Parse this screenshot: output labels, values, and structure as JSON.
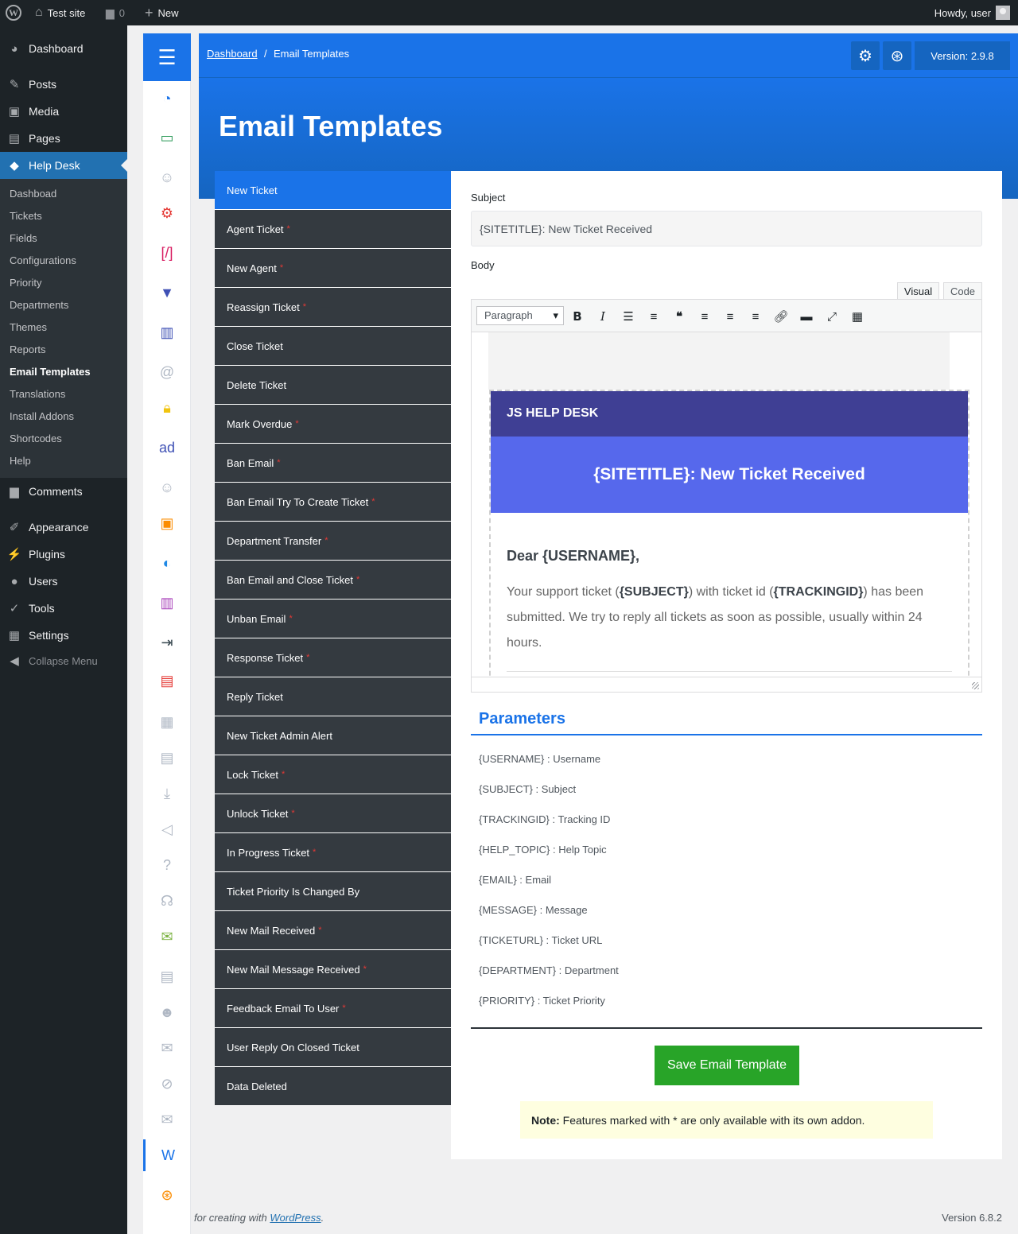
{
  "admin_bar": {
    "site_name": "Test site",
    "comments_count": "0",
    "new_label": "New",
    "howdy": "Howdy, user"
  },
  "admin_menu": {
    "items": [
      {
        "label": "Dashboard",
        "icon": "dashboard-icon"
      },
      {
        "label": "Posts",
        "icon": "pin-icon"
      },
      {
        "label": "Media",
        "icon": "media-icon"
      },
      {
        "label": "Pages",
        "icon": "pages-icon"
      },
      {
        "label": "Help Desk",
        "icon": "tag-icon"
      },
      {
        "label": "Comments",
        "icon": "comment-icon"
      },
      {
        "label": "Appearance",
        "icon": "brush-icon"
      },
      {
        "label": "Plugins",
        "icon": "plug-icon"
      },
      {
        "label": "Users",
        "icon": "user-icon"
      },
      {
        "label": "Tools",
        "icon": "wrench-icon"
      },
      {
        "label": "Settings",
        "icon": "settings-icon"
      },
      {
        "label": "Collapse Menu",
        "icon": "collapse-icon"
      }
    ],
    "submenu": [
      "Dashboad",
      "Tickets",
      "Fields",
      "Configurations",
      "Priority",
      "Departments",
      "Themes",
      "Reports",
      "Email Templates",
      "Translations",
      "Install Addons",
      "Shortcodes",
      "Help"
    ]
  },
  "breadcrumb": {
    "home": "Dashboard",
    "separator": "/",
    "current": "Email Templates"
  },
  "header": {
    "version": "Version: 2.9.8",
    "title": "Email Templates"
  },
  "templates": [
    {
      "label": "New Ticket",
      "addon": false
    },
    {
      "label": "Agent Ticket",
      "addon": true
    },
    {
      "label": "New Agent",
      "addon": true
    },
    {
      "label": "Reassign Ticket",
      "addon": true
    },
    {
      "label": "Close Ticket",
      "addon": false
    },
    {
      "label": "Delete Ticket",
      "addon": false
    },
    {
      "label": "Mark Overdue",
      "addon": true
    },
    {
      "label": "Ban Email",
      "addon": true
    },
    {
      "label": "Ban Email Try To Create Ticket",
      "addon": true
    },
    {
      "label": "Department Transfer",
      "addon": true
    },
    {
      "label": "Ban Email and Close Ticket",
      "addon": true
    },
    {
      "label": "Unban Email",
      "addon": true
    },
    {
      "label": "Response Ticket",
      "addon": true
    },
    {
      "label": "Reply Ticket",
      "addon": false
    },
    {
      "label": "New Ticket Admin Alert",
      "addon": false
    },
    {
      "label": "Lock Ticket",
      "addon": true
    },
    {
      "label": "Unlock Ticket",
      "addon": true
    },
    {
      "label": "In Progress Ticket",
      "addon": true
    },
    {
      "label": "Ticket Priority Is Changed By",
      "addon": false
    },
    {
      "label": "New Mail Received",
      "addon": true
    },
    {
      "label": "New Mail Message Received",
      "addon": true
    },
    {
      "label": "Feedback Email To User",
      "addon": true
    },
    {
      "label": "User Reply On Closed Ticket",
      "addon": false
    },
    {
      "label": "Data Deleted",
      "addon": false
    }
  ],
  "addon_marker": "*",
  "form": {
    "subject_label": "Subject",
    "subject_value": "{SITETITLE}: New Ticket Received",
    "body_label": "Body",
    "tab_visual": "Visual",
    "tab_code": "Code",
    "format_value": "Paragraph"
  },
  "email_preview": {
    "brand": "JS HELP DESK",
    "heading": "{SITETITLE}: New Ticket Received",
    "greeting": "Dear {USERNAME},",
    "text_1": "Your support ticket (",
    "subject_token": "{SUBJECT}",
    "text_2": ") with ticket id (",
    "tracking_token": "{TRACKINGID}",
    "text_3": ") has been submitted. We try to reply all tickets as soon as possible, usually within 24 hours."
  },
  "parameters": {
    "title": "Parameters",
    "items": [
      "{USERNAME} : Username",
      "{SUBJECT} : Subject",
      "{TRACKINGID} : Tracking ID",
      "{HELP_TOPIC} : Help Topic",
      "{EMAIL} : Email",
      "{MESSAGE} : Message",
      "{TICKETURL} : Ticket URL",
      "{DEPARTMENT} : Department",
      "{PRIORITY} : Ticket Priority"
    ]
  },
  "save_button": "Save Email Template",
  "note": {
    "label": "Note:",
    "text": " Features marked with * are only available with its own addon."
  },
  "footer": {
    "left_text": "for creating with ",
    "left_link": "WordPress",
    "left_end": ".",
    "version": "Version 6.8.2"
  },
  "colors": {
    "primary": "#1a73e8",
    "dark_item": "#343a40",
    "save": "#28a428",
    "email_brand": "#3f3f94",
    "email_heading": "#5668ec"
  }
}
